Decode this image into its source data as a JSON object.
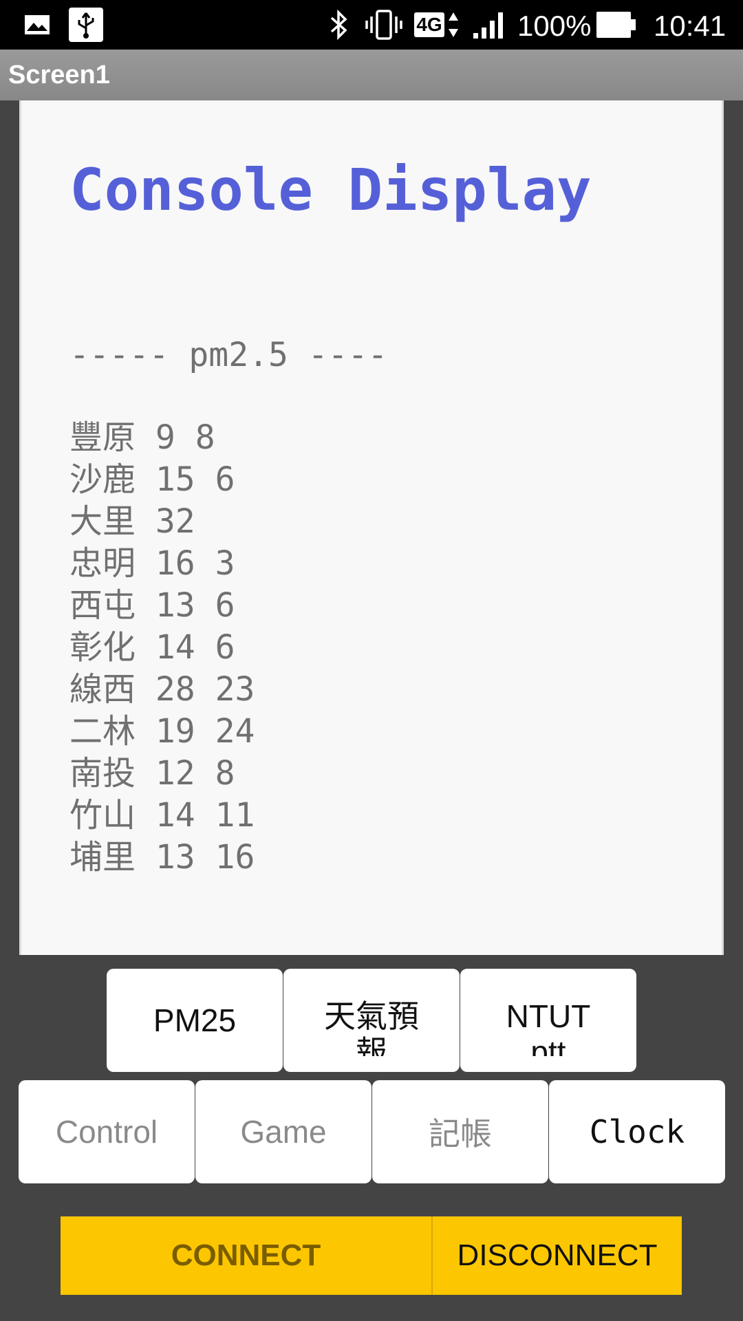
{
  "status_bar": {
    "icons": [
      "gallery-icon",
      "usb-icon",
      "bluetooth-icon",
      "vibrate-icon",
      "lte-icon",
      "signal-icon",
      "battery-icon"
    ],
    "network": "4G",
    "battery": "100%",
    "time": "10:41"
  },
  "screen": {
    "title": "Screen1"
  },
  "console": {
    "title": "Console Display",
    "heading": "----- pm2.5 ----",
    "stations": [
      {
        "line": "豐原 9 8"
      },
      {
        "line": "沙鹿 15 6"
      },
      {
        "line": "大里 32"
      },
      {
        "line": "忠明 16 3"
      },
      {
        "line": "西屯 13 6"
      },
      {
        "line": "彰化 14 6"
      },
      {
        "line": "線西 28 23"
      },
      {
        "line": "二林 19 24"
      },
      {
        "line": "南投 12 8"
      },
      {
        "line": "竹山 14 11"
      },
      {
        "line": "埔里 13 16"
      }
    ]
  },
  "buttons": {
    "pm25": "PM25",
    "weather": "天氣預報",
    "ntut": "NTUT ptt",
    "control": "Control",
    "game": "Game",
    "ledger": "記帳",
    "clock": "Clock"
  },
  "connection": {
    "connect": "CONNECT",
    "disconnect": "DISCONNECT"
  },
  "colors": {
    "accent_title": "#5560d8",
    "connect_bar": "#fcc700",
    "connect_text": "#7a5d00",
    "background": "#444444"
  }
}
